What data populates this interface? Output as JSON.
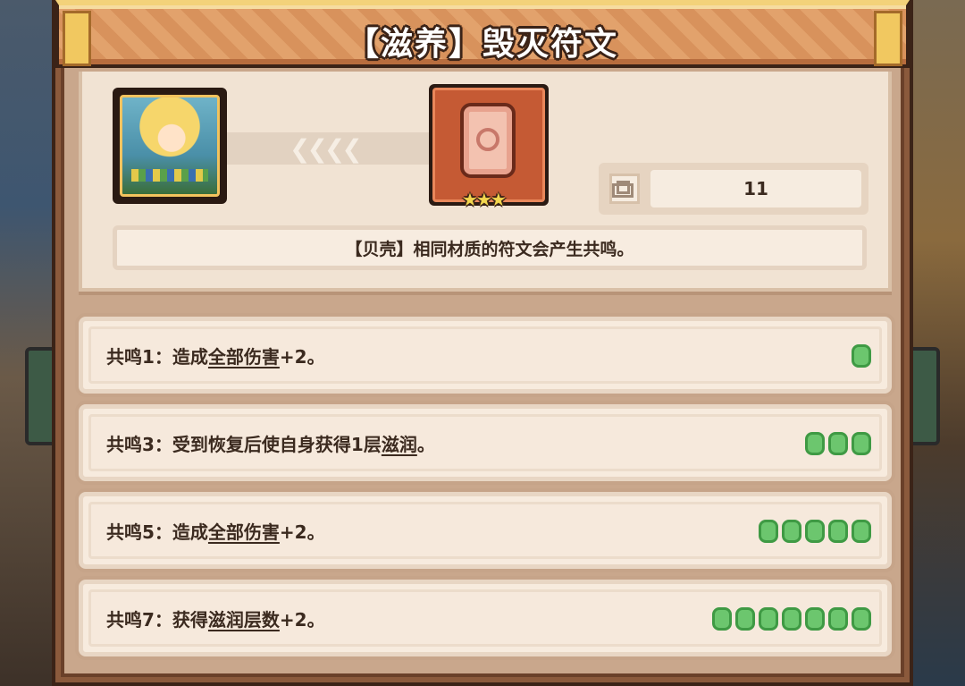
{
  "title": "【滋养】毁灭符文",
  "info": {
    "portrait_icon": "character-portrait-icon",
    "arrow_chevrons": "❮❮❮❮",
    "rune_icon": "rune-stone-icon",
    "rune_stars": "★★★",
    "count_icon": "inventory-grid-icon",
    "count_value": "11",
    "description": "【贝壳】相同材质的符文会产生共鸣。"
  },
  "resonances": [
    {
      "prefix": "共鸣1：造成",
      "link": "全部伤害",
      "suffix": "+2。",
      "pips": 1
    },
    {
      "prefix": "共鸣3：受到恢复后使自身获得1层",
      "link": "滋润",
      "suffix": "。",
      "pips": 3
    },
    {
      "prefix": "共鸣5：造成",
      "link": "全部伤害",
      "suffix": "+2。",
      "pips": 5
    },
    {
      "prefix": "共鸣7：获得",
      "link": "滋润层数",
      "suffix": "+2。",
      "pips": 7
    }
  ],
  "colors": {
    "pip_fill": "#6cc66e",
    "panel_brown": "#8b5a3c",
    "card_bg": "#f1e3d3",
    "title_text": "#ffffff"
  }
}
